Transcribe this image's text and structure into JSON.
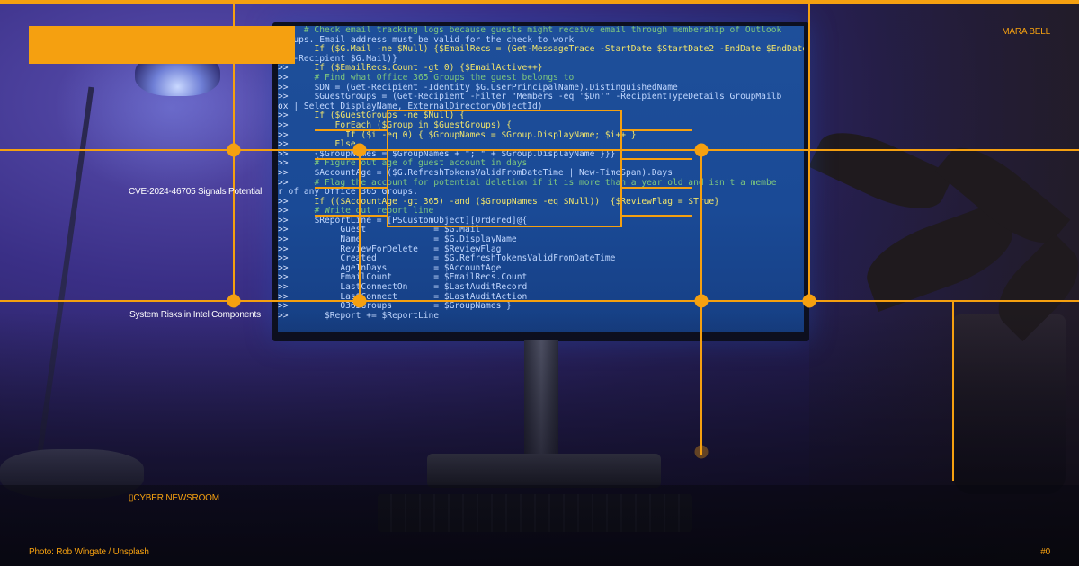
{
  "card": {
    "author": "MARA BELL",
    "headline_1": "CVE-2024-46705 Signals Potential",
    "headline_2": "System Risks in Intel Components",
    "section": "CYBER NEWSROOM",
    "section_glyph": "▯",
    "credit": "Photo: Rob Wingate / Unsplash",
    "number": "#0"
  },
  "colors": {
    "accent": "#f5a010",
    "screen_blue": "#1e4f9a"
  },
  "screen_code": [
    {
      "p": "",
      "t": "     # Check email tracking logs because guests might receive email through membership of Outlook"
    },
    {
      "p": "",
      "t": "Groups. Email address must be valid for the check to work"
    },
    {
      "p": ">>",
      "t": "     If ($G.Mail -ne $Null) {$EmailRecs = (Get-MessageTrace -StartDate $StartDate2 -EndDate $EndDate"
    },
    {
      "p": "te",
      "t": " -Recipient $G.Mail)}"
    },
    {
      "p": ">>",
      "t": "     If ($EmailRecs.Count -gt 0) {$EmailActive++}"
    },
    {
      "p": ">>",
      "t": "     # Find what Office 365 Groups the guest belongs to"
    },
    {
      "p": ">>",
      "t": "     $DN = (Get-Recipient -Identity $G.UserPrincipalName).DistinguishedName"
    },
    {
      "p": ">>",
      "t": "     $GuestGroups = (Get-Recipient -Filter \"Members -eq '$Dn'\" -RecipientTypeDetails GroupMailb"
    },
    {
      "p": "ox",
      "t": " | Select DisplayName, ExternalDirectoryObjectId)"
    },
    {
      "p": ">>",
      "t": "     If ($GuestGroups -ne $Null) {"
    },
    {
      "p": ">>",
      "t": "         ForEach ($Group in $GuestGroups) {"
    },
    {
      "p": ">>",
      "t": "           If ($i -eq 0) { $GroupNames = $Group.DisplayName; $i++ }"
    },
    {
      "p": ">>",
      "t": "         Else"
    },
    {
      "p": ">>",
      "t": "     {$GroupNames = $GroupNames + \"; \" + $Group.DisplayName }}}"
    },
    {
      "p": ">>",
      "t": "     # Figure out age of guest account in days"
    },
    {
      "p": ">>",
      "t": "     $AccountAge = ($G.RefreshTokensValidFromDateTime | New-TimeSpan).Days"
    },
    {
      "p": ">>",
      "t": "     # Flag the account for potential deletion if it is more than a year old and isn't a membe"
    },
    {
      "p": "r",
      "t": " of any Office 365 Groups."
    },
    {
      "p": ">>",
      "t": "     If (($AccountAge -gt 365) -and ($GroupNames -eq $Null))  {$ReviewFlag = $True}"
    },
    {
      "p": ">>",
      "t": "     # Write out report line"
    },
    {
      "p": ">>",
      "t": "     $ReportLine = [PSCustomObject][Ordered]@{"
    },
    {
      "p": ">>",
      "t": "          Guest             = $G.Mail"
    },
    {
      "p": ">>",
      "t": "          Name              = $G.DisplayName"
    },
    {
      "p": ">>",
      "t": "          ReviewForDelete   = $ReviewFlag"
    },
    {
      "p": ">>",
      "t": "          Created           = $G.RefreshTokensValidFromDateTime"
    },
    {
      "p": ">>",
      "t": "          AgeInDays         = $AccountAge"
    },
    {
      "p": ">>",
      "t": "          EmailCount        = $EmailRecs.Count"
    },
    {
      "p": ">>",
      "t": "          LastConnectOn     = $LastAuditRecord"
    },
    {
      "p": ">>",
      "t": "          LastConnect       = $LastAuditAction"
    },
    {
      "p": ">>",
      "t": "          O365Groups        = $GroupNames }"
    },
    {
      "p": ">>",
      "t": "       $Report += $ReportLine"
    }
  ]
}
